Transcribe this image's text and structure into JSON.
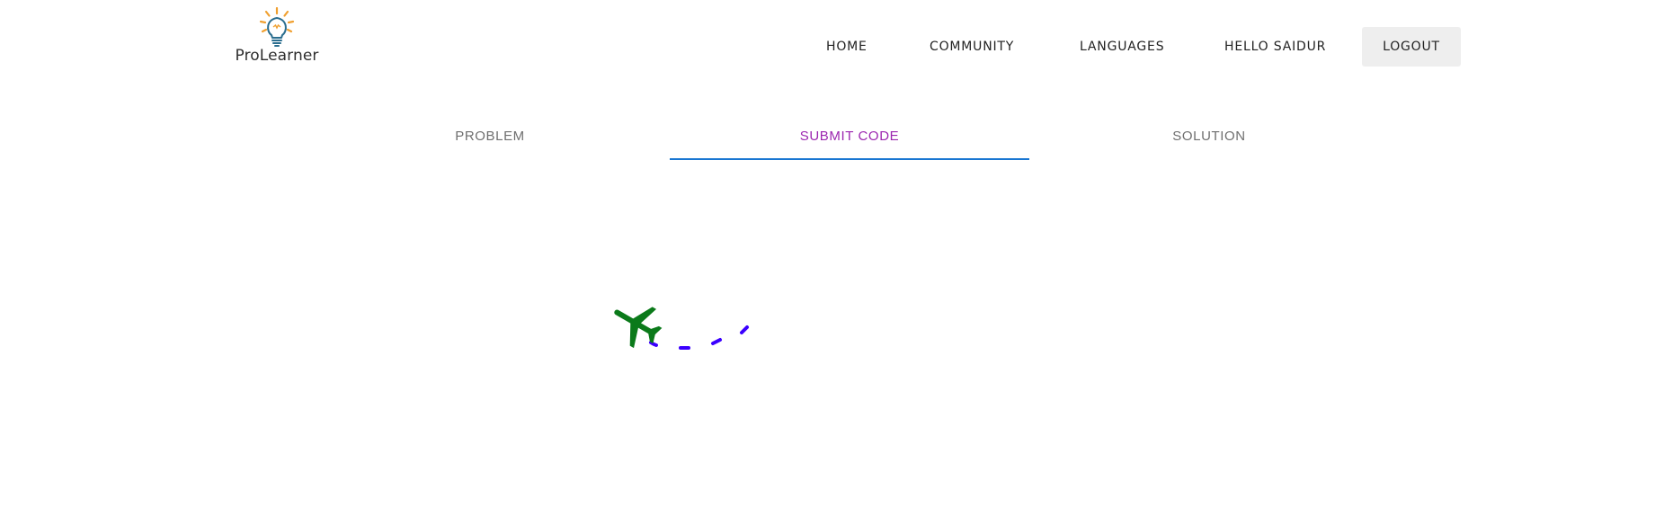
{
  "brand": {
    "name": "ProLearner",
    "icon": "lightbulb-icon",
    "icon_color": "#f0a030",
    "bulb_color": "#2b6e8f"
  },
  "nav": {
    "home": "HOME",
    "community": "COMMUNITY",
    "languages": "LANGUAGES",
    "greeting": "HELLO SAIDUR",
    "logout": "LOGOUT"
  },
  "tabs": {
    "items": [
      {
        "label": "PROBLEM"
      },
      {
        "label": "SUBMIT CODE"
      },
      {
        "label": "SOLUTION"
      }
    ],
    "active": "SUBMIT CODE",
    "active_color": "#9c27b0",
    "indicator_color": "#1976d2"
  },
  "loader": {
    "icon": "airplane-icon",
    "plane_color": "#0b7a1a",
    "trail_color": "#3b00ff"
  }
}
